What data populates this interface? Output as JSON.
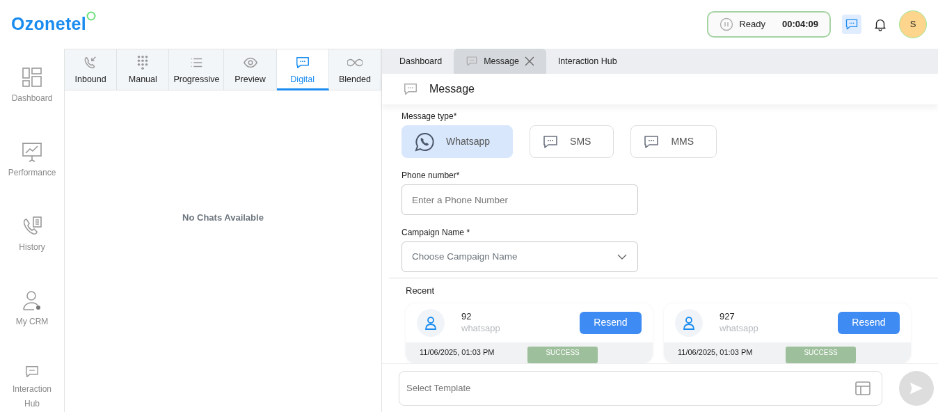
{
  "header": {
    "logo": "Ozonetel",
    "status": {
      "label": "Ready",
      "timer": "00:04:09"
    },
    "avatar": "S"
  },
  "sidebar": {
    "items": [
      {
        "label": "Dashboard"
      },
      {
        "label": "Performance"
      },
      {
        "label": "History"
      },
      {
        "label": "My CRM"
      },
      {
        "label": "Interaction Hub"
      }
    ]
  },
  "dial_tabs": [
    {
      "label": "Inbound",
      "selected": false
    },
    {
      "label": "Manual",
      "selected": false
    },
    {
      "label": "Progressive",
      "selected": false
    },
    {
      "label": "Preview",
      "selected": false
    },
    {
      "label": "Digital",
      "selected": true
    },
    {
      "label": "Blended",
      "selected": false
    }
  ],
  "chat_list": {
    "empty_text": "No Chats Available"
  },
  "page_tabs": [
    {
      "label": "Dashboard",
      "selected": false,
      "closable": false
    },
    {
      "label": "Message",
      "selected": true,
      "closable": true
    },
    {
      "label": "Interaction Hub",
      "selected": false,
      "closable": false
    }
  ],
  "message": {
    "title": "Message",
    "type_label": "Message type*",
    "types": [
      {
        "label": "Whatsapp",
        "selected": true
      },
      {
        "label": "SMS",
        "selected": false
      },
      {
        "label": "MMS",
        "selected": false
      }
    ],
    "phone": {
      "label": "Phone number*",
      "placeholder": "Enter a Phone Number"
    },
    "campaign": {
      "label": "Campaign Name *",
      "placeholder": "Choose Campaign Name"
    }
  },
  "recent": {
    "title": "Recent",
    "items": [
      {
        "number": "92",
        "channel": "whatsapp",
        "button": "Resend",
        "date": "11/06/2025, 01:03 PM",
        "status": "SUCCESS"
      },
      {
        "number": "927",
        "channel": "whatsapp",
        "button": "Resend",
        "date": "11/06/2025, 01:03 PM",
        "status": "SUCCESS"
      }
    ]
  },
  "composer": {
    "placeholder": "Select Template"
  }
}
